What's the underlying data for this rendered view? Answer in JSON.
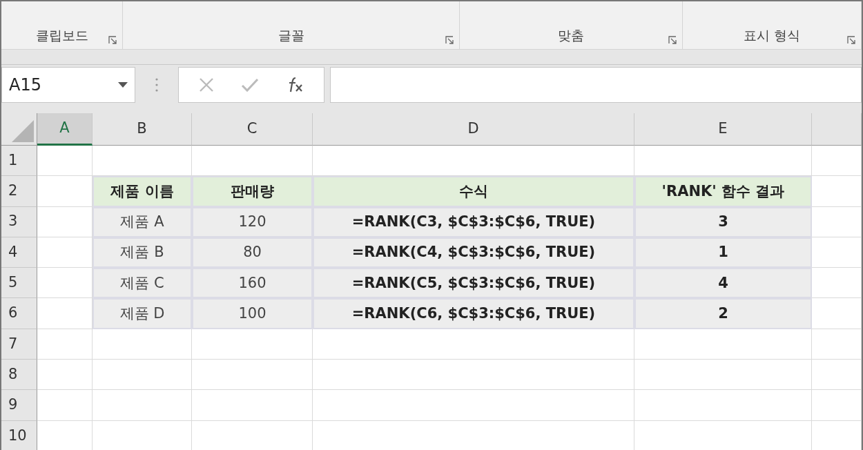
{
  "ribbon": {
    "groups": [
      {
        "label": "클립보드"
      },
      {
        "label": "글꼴"
      },
      {
        "label": "맞춤"
      },
      {
        "label": "표시 형식"
      }
    ]
  },
  "formula_bar": {
    "name_box": "A15"
  },
  "sheet": {
    "columns": [
      {
        "label": "A",
        "selected": true
      },
      {
        "label": "B",
        "selected": false
      },
      {
        "label": "C",
        "selected": false
      },
      {
        "label": "D",
        "selected": false
      },
      {
        "label": "E",
        "selected": false
      }
    ],
    "rows": [
      {
        "number": "1"
      },
      {
        "number": "2",
        "cells": [
          {
            "kind": "header",
            "text": "제품 이름",
            "bold": true
          },
          {
            "kind": "header",
            "text": "판매량",
            "bold": true
          },
          {
            "kind": "header",
            "text": "수식",
            "bold": true
          },
          {
            "kind": "header",
            "text": "'RANK' 함수 결과",
            "bold": true
          }
        ]
      },
      {
        "number": "3",
        "cells": [
          {
            "kind": "data",
            "text": "제품 A",
            "bold": false
          },
          {
            "kind": "data",
            "text": "120",
            "bold": false
          },
          {
            "kind": "data",
            "text": "=RANK(C3, $C$3:$C$6, TRUE)",
            "bold": true
          },
          {
            "kind": "data",
            "text": "3",
            "bold": true
          }
        ]
      },
      {
        "number": "4",
        "cells": [
          {
            "kind": "data",
            "text": "제품 B",
            "bold": false
          },
          {
            "kind": "data",
            "text": "80",
            "bold": false
          },
          {
            "kind": "data",
            "text": "=RANK(C4, $C$3:$C$6, TRUE)",
            "bold": true
          },
          {
            "kind": "data",
            "text": "1",
            "bold": true
          }
        ]
      },
      {
        "number": "5",
        "cells": [
          {
            "kind": "data",
            "text": "제품 C",
            "bold": false
          },
          {
            "kind": "data",
            "text": "160",
            "bold": false
          },
          {
            "kind": "data",
            "text": "=RANK(C5, $C$3:$C$6, TRUE)",
            "bold": true
          },
          {
            "kind": "data",
            "text": "4",
            "bold": true
          }
        ]
      },
      {
        "number": "6",
        "cells": [
          {
            "kind": "data",
            "text": "제품 D",
            "bold": false
          },
          {
            "kind": "data",
            "text": "100",
            "bold": false
          },
          {
            "kind": "data",
            "text": "=RANK(C6, $C$3:$C$6, TRUE)",
            "bold": true
          },
          {
            "kind": "data",
            "text": "2",
            "bold": true
          }
        ]
      },
      {
        "number": "7"
      },
      {
        "number": "8"
      },
      {
        "number": "9"
      },
      {
        "number": "10"
      }
    ]
  }
}
